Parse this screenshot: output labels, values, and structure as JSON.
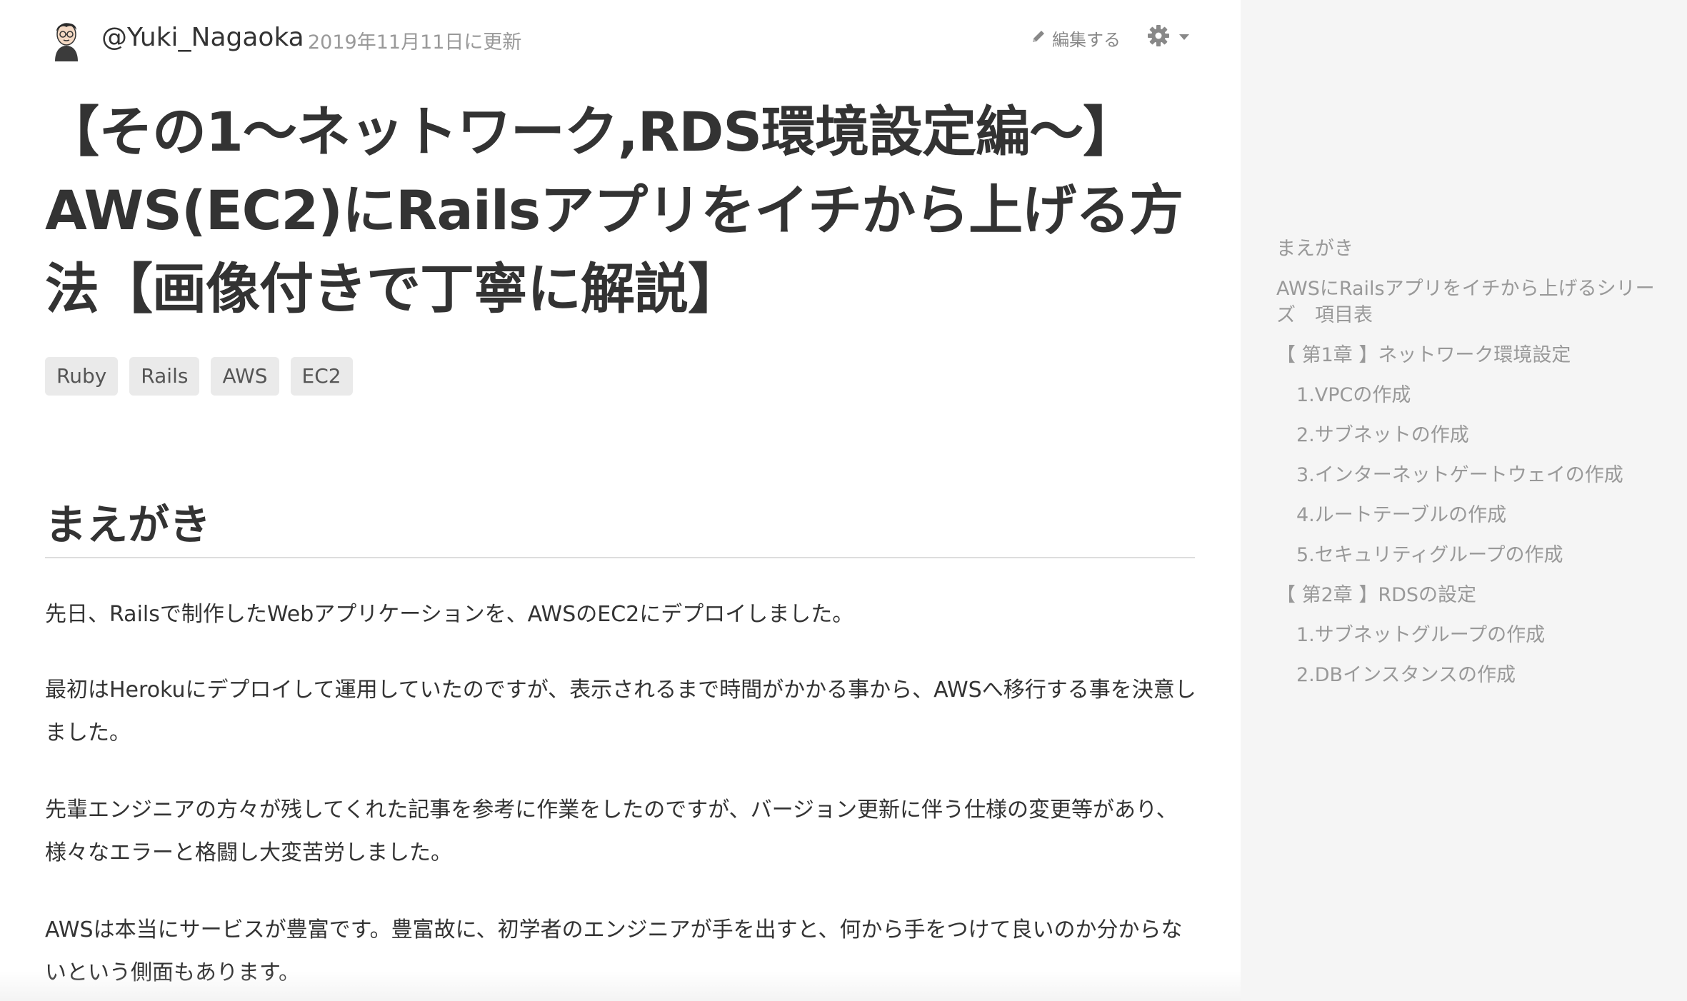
{
  "header": {
    "username": "@Yuki_Nagaoka",
    "updated": "2019年11月11日に更新",
    "edit_label": "編集する"
  },
  "article": {
    "title_line1": "【その1〜ネットワーク,RDS環境設定編〜】",
    "title_line2": "AWS(EC2)にRailsアプリをイチから上げる方",
    "title_line3": "法【画像付きで丁寧に解説】",
    "tags": [
      "Ruby",
      "Rails",
      "AWS",
      "EC2"
    ],
    "section_heading": "まえがき",
    "paragraphs": [
      "先日、Railsで制作したWebアプリケーションを、AWSのEC2にデプロイしました。",
      "最初はHerokuにデプロイして運用していたのですが、表示されるまで時間がかかる事から、AWSへ移行する事を決意しました。",
      "先輩エンジニアの方々が残してくれた記事を参考に作業をしたのですが、バージョン更新に伴う仕様の変更等があり、様々なエラーと格闘し大変苦労しました。",
      "AWSは本当にサービスが豊富です。豊富故に、初学者のエンジニアが手を出すと、何から手をつけて良いのか分からないという側面もあります。"
    ]
  },
  "toc": {
    "items": [
      {
        "label": "まえがき",
        "level": 1
      },
      {
        "label": "AWSにRailsアプリをイチから上げるシリーズ　項目表",
        "level": 1
      },
      {
        "label": "【 第1章 】ネットワーク環境設定",
        "level": 1
      },
      {
        "label": "1.VPCの作成",
        "level": 2
      },
      {
        "label": "2.サブネットの作成",
        "level": 2
      },
      {
        "label": "3.インターネットゲートウェイの作成",
        "level": 2
      },
      {
        "label": "4.ルートテーブルの作成",
        "level": 2
      },
      {
        "label": "5.セキュリティグループの作成",
        "level": 2
      },
      {
        "label": "【 第2章 】RDSの設定",
        "level": 1
      },
      {
        "label": "1.サブネットグループの作成",
        "level": 2
      },
      {
        "label": "2.DBインスタンスの作成",
        "level": 2
      }
    ]
  },
  "icons": {
    "edit": "pencil-icon",
    "settings": "gear-icon",
    "dropdown": "caret-down-icon"
  },
  "colors": {
    "text": "#333333",
    "muted": "#999999",
    "sidebar_bg": "#f5f5f5",
    "tag_bg": "#eaeaea"
  }
}
